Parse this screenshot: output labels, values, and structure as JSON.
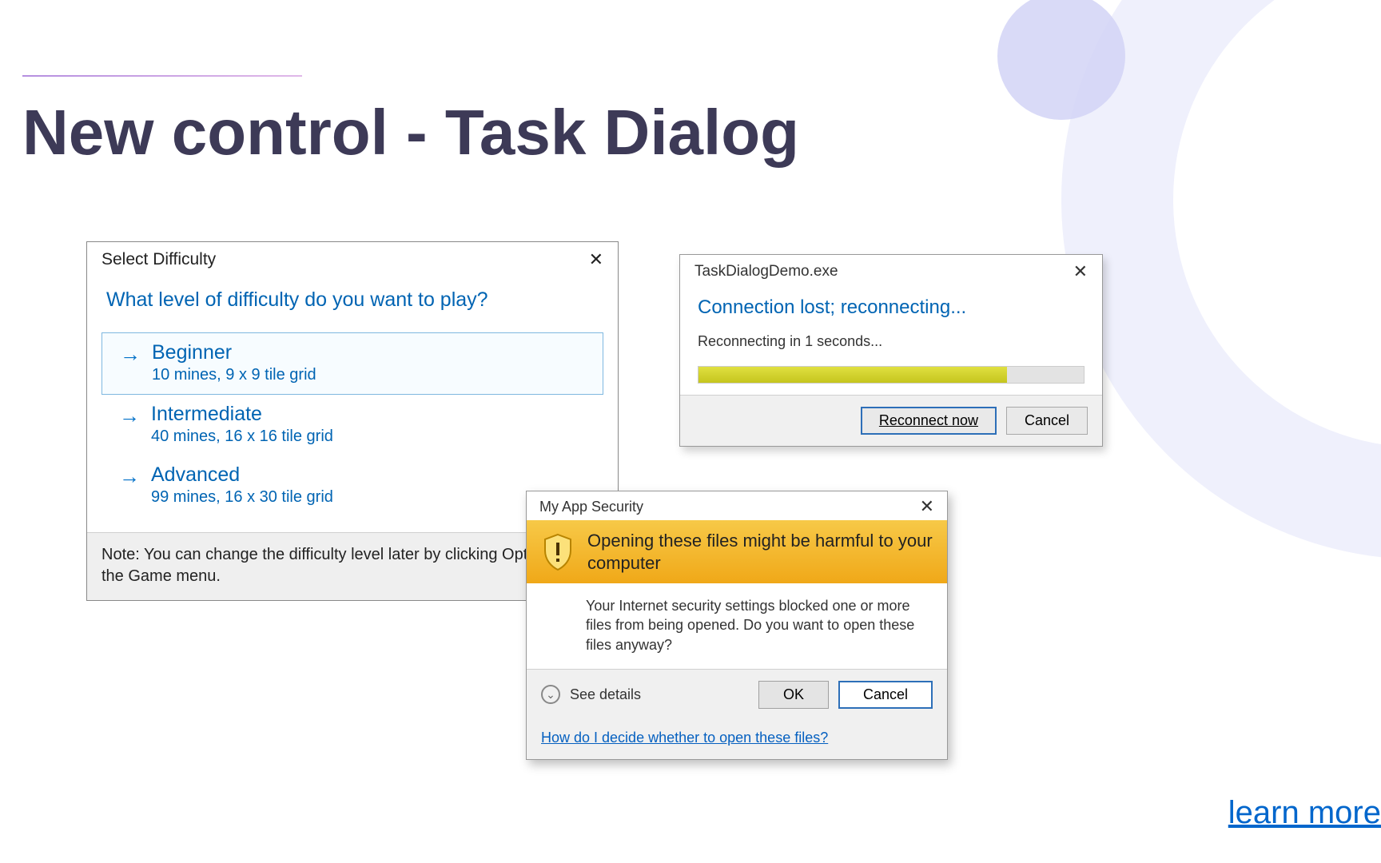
{
  "title": "New control - Task Dialog",
  "learn_more": "learn more",
  "dialog1": {
    "title": "Select Difficulty",
    "instruction": "What level of difficulty do you want to play?",
    "options": [
      {
        "label": "Beginner",
        "sub": "10 mines, 9 x 9 tile grid"
      },
      {
        "label": "Intermediate",
        "sub": "40 mines, 16 x 16 tile grid"
      },
      {
        "label": "Advanced",
        "sub": "99 mines, 16 x 30 tile grid"
      }
    ],
    "footer": "Note: You can change the difficulty level later by clicking Options on the Game menu."
  },
  "dialog2": {
    "title": "TaskDialogDemo.exe",
    "instruction": "Connection lost; reconnecting...",
    "content": "Reconnecting in 1 seconds...",
    "progress_percent": 80,
    "buttons": {
      "primary": "Reconnect now",
      "cancel": "Cancel"
    }
  },
  "dialog3": {
    "title": "My App Security",
    "banner": "Opening these files might be harmful to your computer",
    "content": "Your Internet security settings blocked one or more files from being opened. Do you want to open these files anyway?",
    "see_details": "See details",
    "buttons": {
      "ok": "OK",
      "cancel": "Cancel"
    },
    "link": "How do I decide whether to open these files?"
  }
}
